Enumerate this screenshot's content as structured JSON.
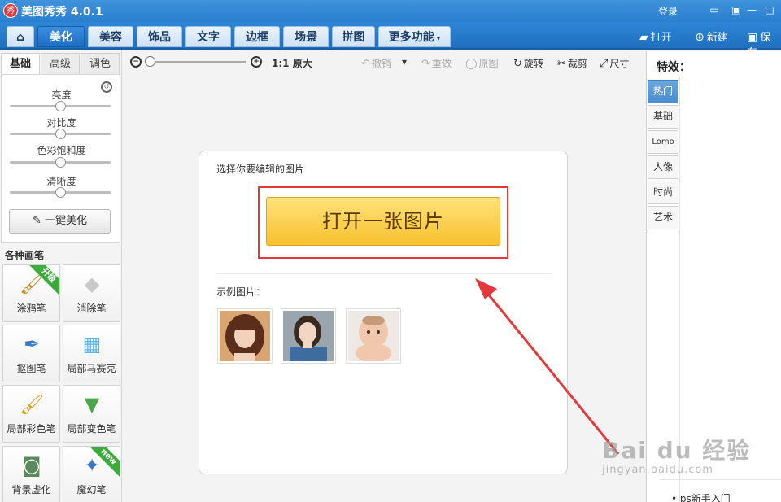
{
  "window": {
    "title": "美图秀秀 4.0.1",
    "logo_text": "秀",
    "login": "登录"
  },
  "menu": {
    "tabs": [
      "美化",
      "美容",
      "饰品",
      "文字",
      "边框",
      "场景",
      "拼图"
    ],
    "more": "更多功能",
    "open": "打开",
    "new": "新建",
    "save": "保存"
  },
  "left": {
    "subtabs": [
      "基础",
      "高级",
      "调色"
    ],
    "sliders": [
      {
        "label": "亮度",
        "value": 0.5
      },
      {
        "label": "对比度",
        "value": 0.5
      },
      {
        "label": "色彩饱和度",
        "value": 0.5
      },
      {
        "label": "清晰度",
        "value": 0.5
      }
    ],
    "onekey": "一键美化",
    "brush_title": "各种画笔",
    "tools": [
      {
        "label": "涂鸦笔",
        "icon": "brush-icon",
        "badge": "升级"
      },
      {
        "label": "消除笔",
        "icon": "eraser-icon",
        "badge": ""
      },
      {
        "label": "抠图笔",
        "icon": "pen-icon",
        "badge": ""
      },
      {
        "label": "局部马赛克",
        "icon": "mosaic-icon",
        "badge": ""
      },
      {
        "label": "局部彩色笔",
        "icon": "color-brush-icon",
        "badge": ""
      },
      {
        "label": "局部变色笔",
        "icon": "color-change-icon",
        "badge": ""
      },
      {
        "label": "背景虚化",
        "icon": "blur-icon",
        "badge": ""
      },
      {
        "label": "魔幻笔",
        "icon": "magic-wand-icon",
        "badge": "new"
      }
    ]
  },
  "toolbar": {
    "zoom_value": 0.0,
    "ratio": "1:1",
    "original_size": "原大",
    "undo": "撤销",
    "redo": "重做",
    "original": "原图",
    "rotate": "旋转",
    "crop": "裁剪",
    "resize": "尺寸"
  },
  "card": {
    "prompt": "选择你要编辑的图片",
    "open_button": "打开一张图片",
    "sample_label": "示例图片："
  },
  "right": {
    "title": "特效：",
    "tabs": [
      "热门",
      "基础",
      "Lomo",
      "人像",
      "时尚",
      "艺术"
    ],
    "news_item": "ps新手入门"
  },
  "watermark": {
    "main": "Bai du 经验",
    "sub": "jingyan.baidu.com"
  },
  "colors": {
    "accent": "#2a7fcf",
    "highlight": "#e4393c",
    "button_yellow": "#f8c12e"
  }
}
